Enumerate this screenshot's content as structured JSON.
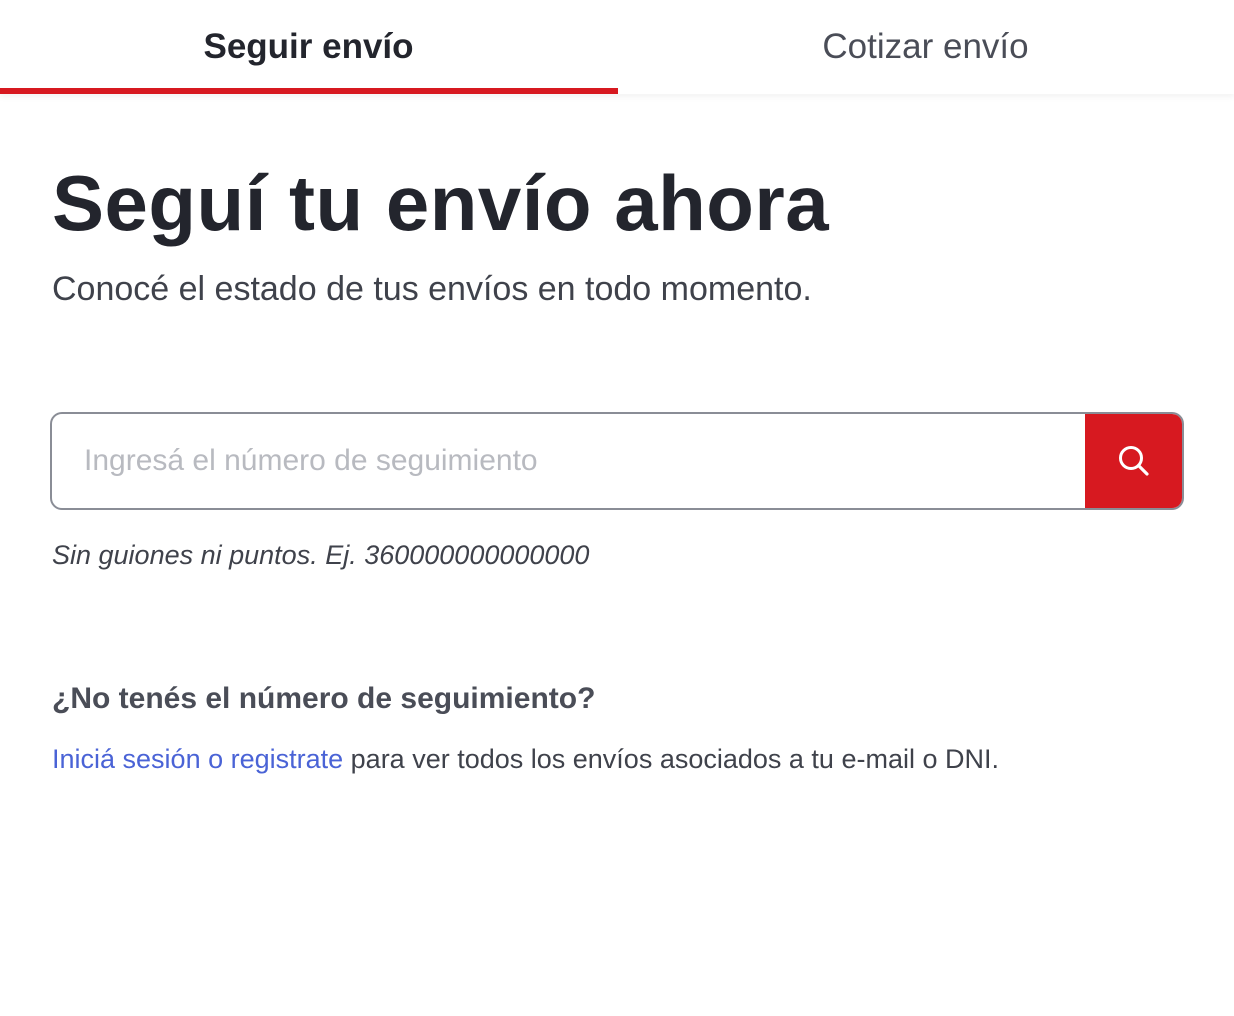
{
  "tabs": {
    "track_label": "Seguir envío",
    "quote_label": "Cotizar envío"
  },
  "hero": {
    "title": "Seguí tu envío ahora",
    "subtitle": "Conocé el estado de tus envíos en todo momento."
  },
  "search": {
    "placeholder": "Ingresá el número de seguimiento",
    "value": "",
    "button_icon": "search-icon",
    "hint": "Sin guiones ni puntos. Ej. 360000000000000"
  },
  "no_number": {
    "question": "¿No tenés el número de seguimiento?",
    "link_text": "Iniciá sesión o registrate",
    "rest_text": " para ver todos los envíos asociados a tu e-mail o DNI."
  },
  "colors": {
    "accent": "#d71920",
    "link": "#4a63d6",
    "text": "#23252d"
  }
}
